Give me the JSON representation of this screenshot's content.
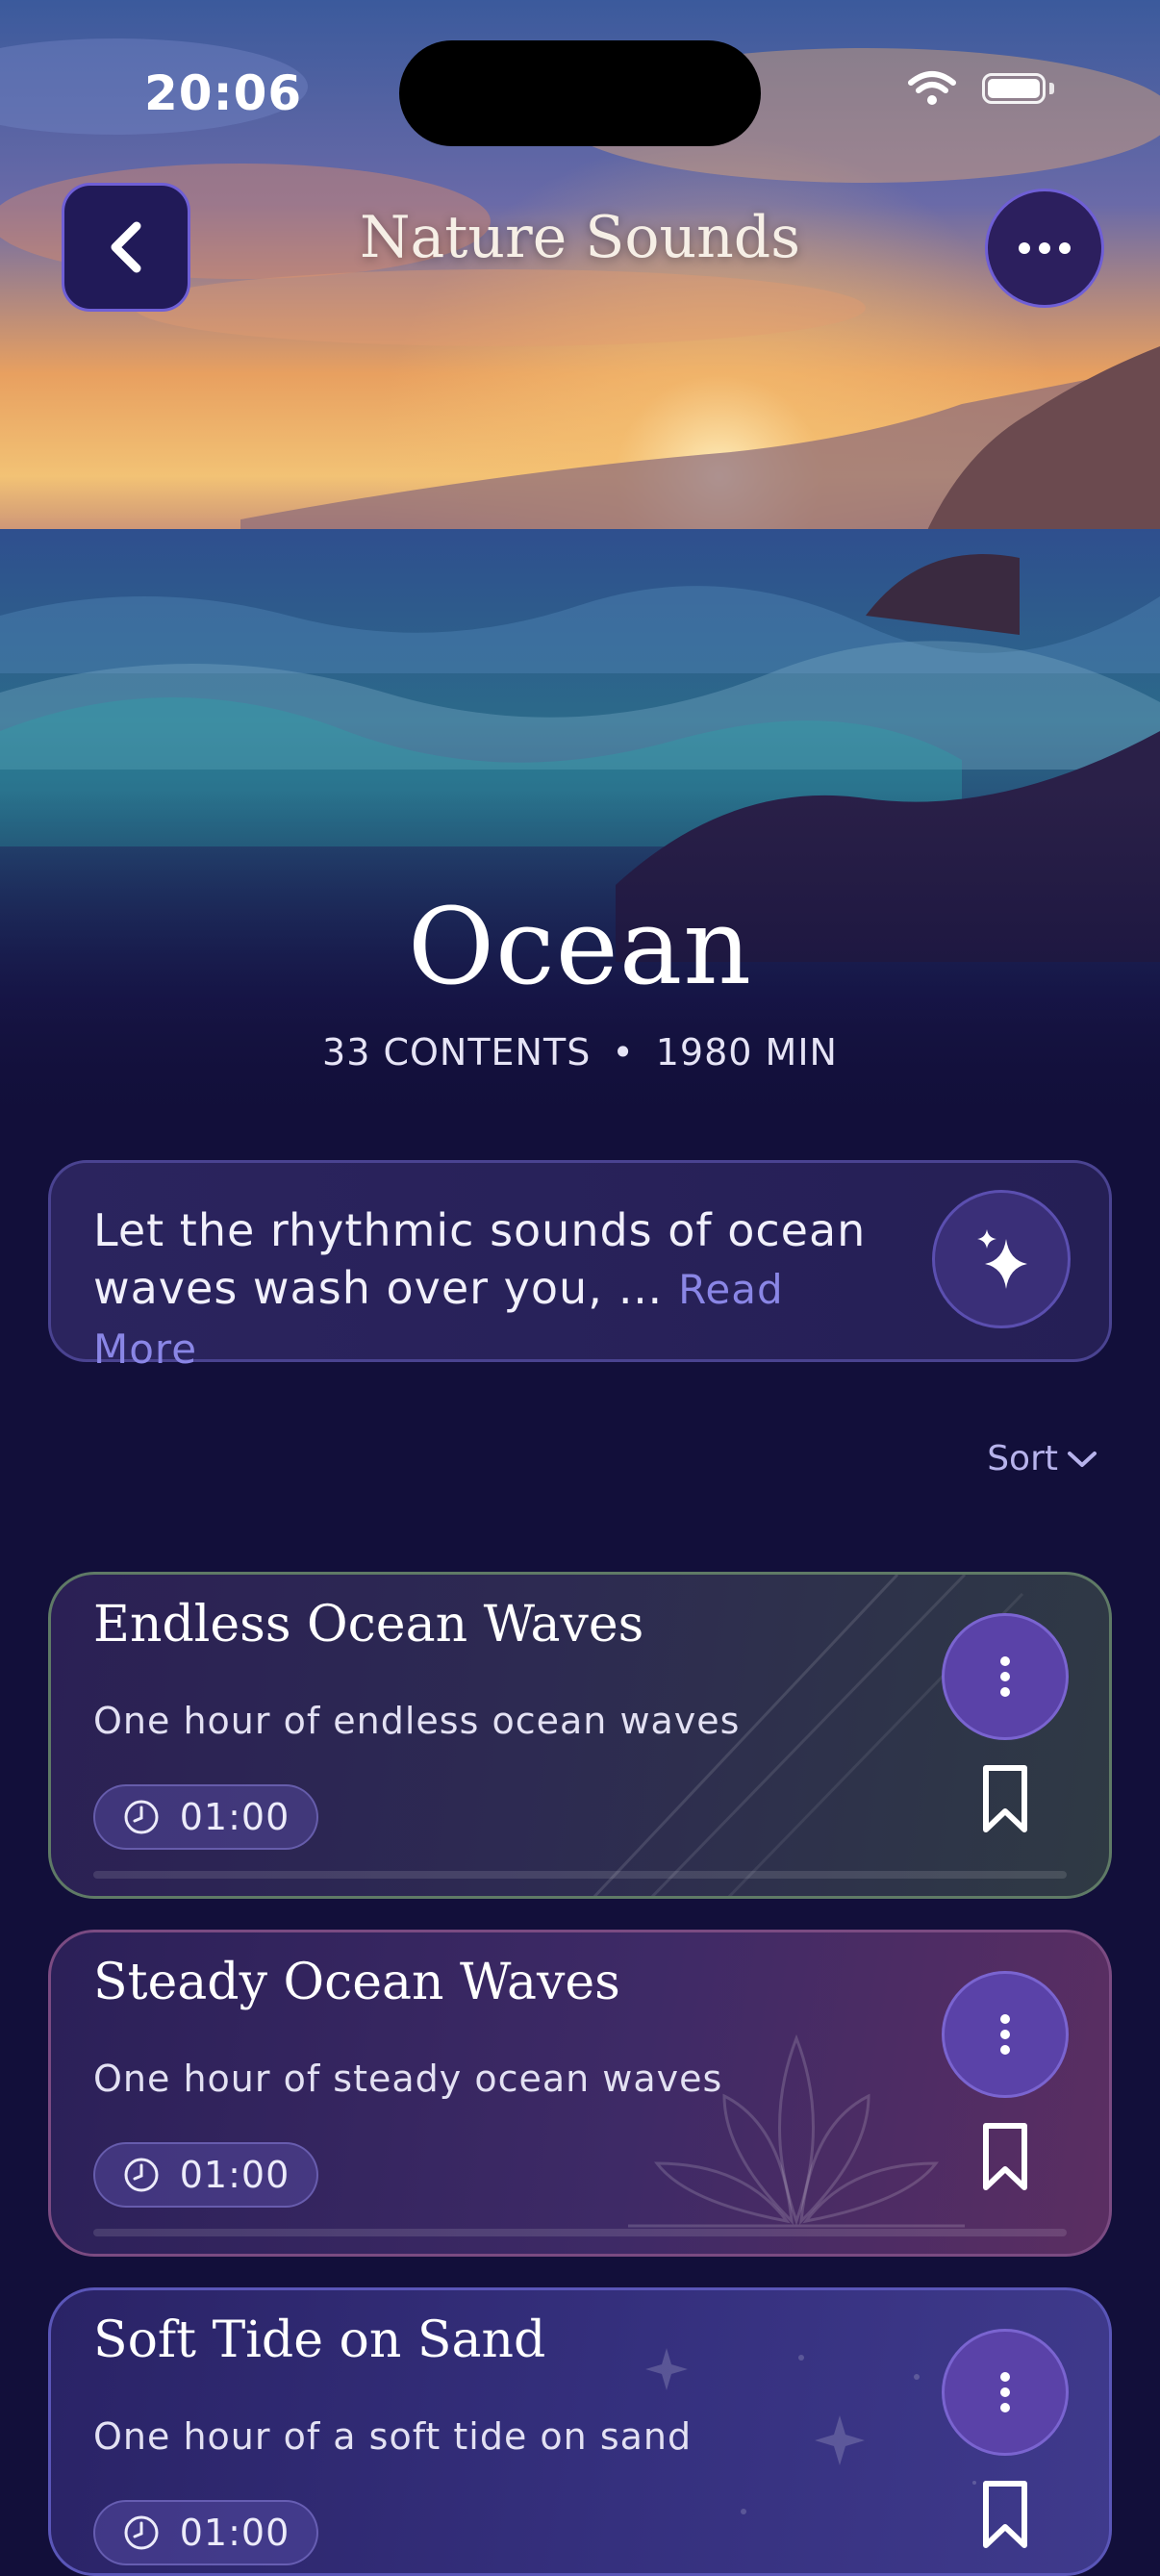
{
  "status_bar": {
    "time": "20:06"
  },
  "header": {
    "title": "Nature Sounds"
  },
  "collection": {
    "title": "Ocean",
    "contents": "33 CONTENTS",
    "separator": "•",
    "duration": "1980 MIN"
  },
  "description": {
    "text": "Let the rhythmic sounds of ocean waves wash over you, …",
    "read_more": "Read More"
  },
  "sort": {
    "label": "Sort"
  },
  "tracks": [
    {
      "title": "Endless Ocean Waves",
      "subtitle": "One hour of endless ocean waves",
      "duration": "01:00",
      "progress": 0
    },
    {
      "title": "Steady Ocean Waves",
      "subtitle": "One hour of steady ocean waves",
      "duration": "01:00",
      "progress": 0
    },
    {
      "title": "Soft Tide on Sand",
      "subtitle": "One hour of a soft tide on sand",
      "duration": "01:00",
      "progress": 0
    }
  ],
  "icons": {
    "back": "chevron-left-icon",
    "more": "ellipsis-horizontal-icon",
    "sparkle": "sparkle-icon",
    "sort": "chevron-down-icon",
    "track_menu": "ellipsis-vertical-icon",
    "bookmark": "bookmark-icon",
    "clock": "clock-icon"
  },
  "colors": {
    "background": "#120f3a",
    "accent": "#8a86e6",
    "button": "#5a42a8"
  }
}
